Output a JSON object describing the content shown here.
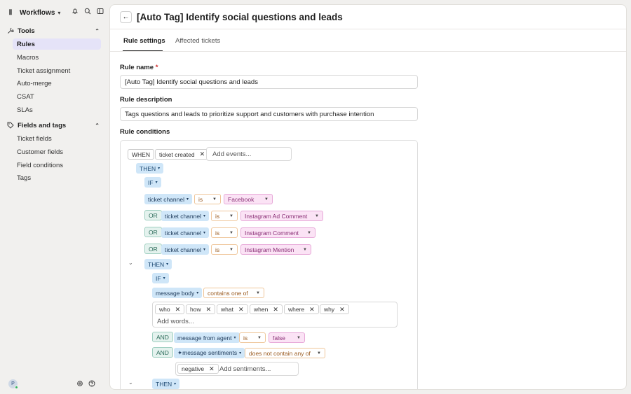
{
  "workspace": {
    "logo": "Ⅱ",
    "title": "Workflows"
  },
  "sidebar": {
    "tools_heading": "Tools",
    "tools_items": [
      "Rules",
      "Macros",
      "Ticket assignment",
      "Auto-merge",
      "CSAT",
      "SLAs"
    ],
    "fields_heading": "Fields and tags",
    "fields_items": [
      "Ticket fields",
      "Customer fields",
      "Field conditions",
      "Tags"
    ],
    "active_item": "Rules",
    "avatar_initial": "P"
  },
  "page": {
    "title": "[Auto Tag] Identify social questions and leads",
    "tabs": [
      "Rule settings",
      "Affected tickets"
    ],
    "active_tab": "Rule settings"
  },
  "form": {
    "name_label": "Rule name",
    "required_mark": "*",
    "name_value": "[Auto Tag] Identify social questions and leads",
    "desc_label": "Rule description",
    "desc_value": "Tags questions and leads to prioritize support and customers with purchase intention",
    "conditions_label": "Rule conditions"
  },
  "conditions": {
    "when": "WHEN",
    "event_chip": "ticket created",
    "add_events_placeholder": "Add events...",
    "then": "THEN",
    "if": "IF",
    "or": "OR",
    "and": "AND",
    "ticket_channel": "ticket channel",
    "is": "is",
    "facebook": "Facebook",
    "ig_ad": "Instagram Ad Comment",
    "ig_comment": "Instagram Comment",
    "ig_mention": "Instagram Mention",
    "message_body": "message body",
    "contains_one_of": "contains one of",
    "words": [
      "who",
      "how",
      "what",
      "when",
      "where",
      "why"
    ],
    "add_words_placeholder": "Add words...",
    "message_from_agent": "message from agent",
    "false": "false",
    "message_sentiments": "✦message sentiments",
    "does_not_contain": "does not contain any of",
    "negative": "negative",
    "add_sentiments_placeholder": "Add sentiments..."
  },
  "colors": {
    "active_nav_bg": "#e5e3f8",
    "variable_chip": "#cfe6f8",
    "value_chip": "#fbe3f5",
    "operator_border": "#efc69a",
    "logic_chip": "#e4f2ee"
  }
}
